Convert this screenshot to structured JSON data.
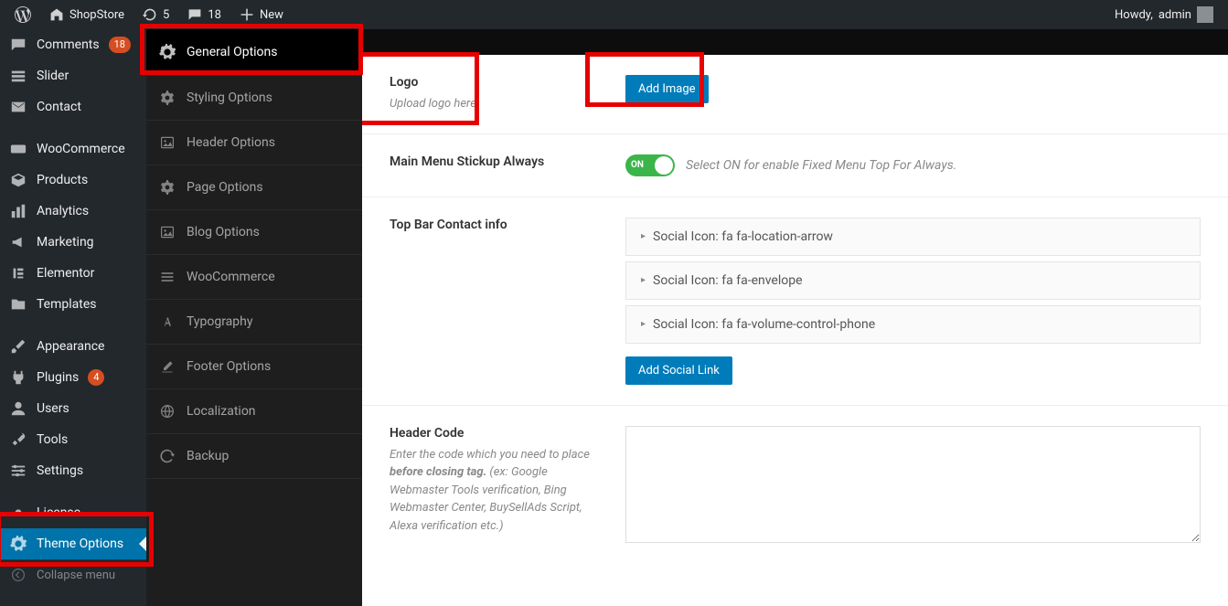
{
  "toolbar": {
    "site_name": "ShopStore",
    "updates_count": "5",
    "comments_count": "18",
    "new_label": "New",
    "howdy_prefix": "Howdy, ",
    "user": "admin"
  },
  "admin_menu": {
    "items": [
      {
        "label": "Comments",
        "icon": "comment",
        "badge": "18"
      },
      {
        "label": "Slider",
        "icon": "slider"
      },
      {
        "label": "Contact",
        "icon": "envelope"
      },
      {
        "label": "WooCommerce",
        "icon": "woo"
      },
      {
        "label": "Products",
        "icon": "cube"
      },
      {
        "label": "Analytics",
        "icon": "chart"
      },
      {
        "label": "Marketing",
        "icon": "megaphone"
      },
      {
        "label": "Elementor",
        "icon": "elementor"
      },
      {
        "label": "Templates",
        "icon": "folder"
      },
      {
        "label": "Appearance",
        "icon": "brush"
      },
      {
        "label": "Plugins",
        "icon": "plug",
        "badge": "4"
      },
      {
        "label": "Users",
        "icon": "user"
      },
      {
        "label": "Tools",
        "icon": "wrench"
      },
      {
        "label": "Settings",
        "icon": "sliders"
      },
      {
        "label": "License",
        "icon": "gear-cut"
      },
      {
        "label": "Theme Options",
        "icon": "gear",
        "active": true
      }
    ],
    "collapse_label": "Collapse menu"
  },
  "options_menu": {
    "items": [
      {
        "label": "General Options",
        "icon": "gear",
        "active": true
      },
      {
        "label": "Styling Options",
        "icon": "gear-alt"
      },
      {
        "label": "Header Options",
        "icon": "image"
      },
      {
        "label": "Page Options",
        "icon": "gear-alt"
      },
      {
        "label": "Blog Options",
        "icon": "image"
      },
      {
        "label": "WooCommerce",
        "icon": "bars"
      },
      {
        "label": "Typography",
        "icon": "font"
      },
      {
        "label": "Footer Options",
        "icon": "edit"
      },
      {
        "label": "Localization",
        "icon": "globe"
      },
      {
        "label": "Backup",
        "icon": "refresh"
      }
    ]
  },
  "sections": {
    "logo": {
      "title": "Logo",
      "hint": "Upload logo here",
      "button": "Add Image"
    },
    "menu_stickup": {
      "title": "Main Menu Stickup Always",
      "toggle_label": "ON",
      "hint": "Select ON for enable Fixed Menu Top For Always."
    },
    "topbar": {
      "title": "Top Bar Contact info",
      "items": [
        "Social Icon: fa fa-location-arrow",
        "Social Icon: fa fa-envelope",
        "Social Icon: fa fa-volume-control-phone"
      ],
      "add_button": "Add Social Link"
    },
    "header_code": {
      "title": "Header Code",
      "hint_pre": "Enter the code which you need to place ",
      "hint_bold": "before closing tag.",
      "hint_post": " (ex: Google Webmaster Tools verification, Bing Webmaster Center, BuySellAds Script, Alexa verification etc.)"
    }
  }
}
